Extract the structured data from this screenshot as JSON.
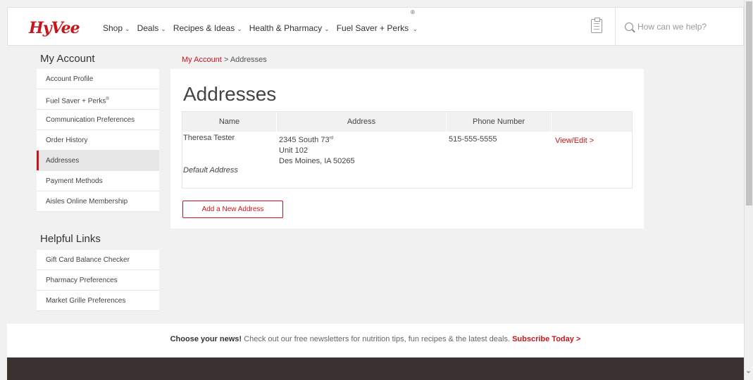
{
  "header": {
    "logo": "HyVee",
    "nav": [
      {
        "label": "Shop"
      },
      {
        "label": "Deals"
      },
      {
        "label": "Recipes & Ideas"
      },
      {
        "label": "Health & Pharmacy"
      },
      {
        "label": "Fuel Saver + Perks"
      }
    ],
    "registered_mark": "®",
    "search_placeholder": "How can we help?"
  },
  "sidebar": {
    "account_title": "My Account",
    "account_items": [
      {
        "label": "Account Profile"
      },
      {
        "label": "Fuel Saver + Perks",
        "sup": "®"
      },
      {
        "label": "Communication Preferences"
      },
      {
        "label": "Order History"
      },
      {
        "label": "Addresses"
      },
      {
        "label": "Payment Methods"
      },
      {
        "label": "Aisles Online Membership"
      }
    ],
    "helpful_title": "Helpful Links",
    "helpful_items": [
      {
        "label": "Gift Card Balance Checker"
      },
      {
        "label": "Pharmacy Preferences"
      },
      {
        "label": "Market Grille Preferences"
      }
    ]
  },
  "breadcrumb": {
    "link": "My Account",
    "separator": ">",
    "current": "Addresses"
  },
  "main": {
    "title": "Addresses",
    "columns": [
      "Name",
      "Address",
      "Phone Number"
    ],
    "rows": [
      {
        "name": "Theresa Tester",
        "address_line1": "2345 South 73",
        "address_line1_sup": "rd",
        "address_line2": "Unit 102",
        "address_line3": "Des Moines, IA 50265",
        "phone": "515-555-5555",
        "action": "View/Edit >",
        "default_label": "Default Address"
      }
    ],
    "add_button": "Add a New Address"
  },
  "newsletter": {
    "lead": "Choose your news!",
    "body": "Check out our free newsletters for nutrition tips, fun recipes & the latest deals.",
    "link": "Subscribe Today >"
  },
  "colors": {
    "brand_red": "#c4161c",
    "page_bg": "#f1f1f1",
    "footer_bg": "#3a3230"
  }
}
